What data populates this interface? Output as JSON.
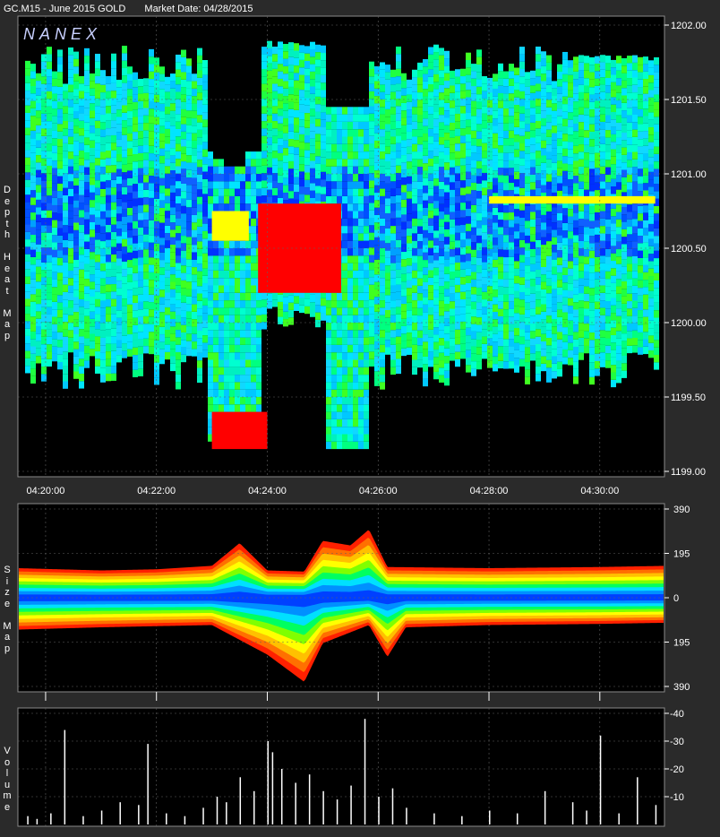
{
  "header": {
    "symbol": "GC.M15 - June 2015 GOLD",
    "market_date": "Market Date: 04/28/2015"
  },
  "brand": {
    "name": "NANEX"
  },
  "colors": {
    "background": "#000000",
    "panel_border": "#8a8a8a",
    "grid": "#606060",
    "heat_low": "#00e5ff",
    "heat_mid": "#00ff60",
    "heat_high": "#ffff00",
    "heat_max": "#ff0000",
    "heat_deep": "#0030ff",
    "volume_bar": "#ffffff"
  },
  "chart_data": [
    {
      "type": "heatmap",
      "title": "Depth Heat Map",
      "ylabel": "Depth Heat Map",
      "ylim": [
        1199.0,
        1202.0
      ],
      "y_ticks": [
        "1202.00",
        "1201.50",
        "1201.00",
        "1200.50",
        "1200.00",
        "1199.50",
        "1199.00"
      ],
      "x_ticks": [
        "04:20:00",
        "04:22:00",
        "04:24:00",
        "04:26:00",
        "04:28:00",
        "04:30:00"
      ],
      "x_range": [
        "04:19:30",
        "04:31:10"
      ],
      "grid": true,
      "hot_zones": [
        {
          "time_from": "04:23:50",
          "time_to": "04:25:20",
          "price_from": 1200.2,
          "price_to": 1200.8,
          "level": "max"
        },
        {
          "time_from": "04:23:00",
          "time_to": "04:23:40",
          "price_from": 1200.55,
          "price_to": 1200.75,
          "level": "high"
        },
        {
          "time_from": "04:28:00",
          "time_to": "04:31:00",
          "price_from": 1200.8,
          "price_to": 1200.85,
          "level": "high"
        },
        {
          "time_from": "04:23:00",
          "time_to": "04:24:00",
          "price_from": 1199.15,
          "price_to": 1199.4,
          "level": "max"
        }
      ]
    },
    {
      "type": "area",
      "title": "Size Map",
      "ylabel": "Size Map",
      "ylim": [
        -390,
        390
      ],
      "y_ticks": [
        "390",
        "195",
        "0",
        "195",
        "390"
      ],
      "grid": true,
      "upper_envelope": [
        {
          "t": "04:19:30",
          "v": 130
        },
        {
          "t": "04:21:00",
          "v": 120
        },
        {
          "t": "04:22:00",
          "v": 125
        },
        {
          "t": "04:23:00",
          "v": 140
        },
        {
          "t": "04:23:30",
          "v": 240
        },
        {
          "t": "04:24:00",
          "v": 120
        },
        {
          "t": "04:24:40",
          "v": 115
        },
        {
          "t": "04:25:00",
          "v": 250
        },
        {
          "t": "04:25:30",
          "v": 230
        },
        {
          "t": "04:25:50",
          "v": 300
        },
        {
          "t": "04:26:10",
          "v": 135
        },
        {
          "t": "04:28:00",
          "v": 130
        },
        {
          "t": "04:30:00",
          "v": 135
        },
        {
          "t": "04:31:10",
          "v": 140
        }
      ],
      "lower_envelope": [
        {
          "t": "04:19:30",
          "v": -140
        },
        {
          "t": "04:21:00",
          "v": -130
        },
        {
          "t": "04:22:00",
          "v": -125
        },
        {
          "t": "04:23:00",
          "v": -120
        },
        {
          "t": "04:24:00",
          "v": -250
        },
        {
          "t": "04:24:40",
          "v": -370
        },
        {
          "t": "04:25:00",
          "v": -200
        },
        {
          "t": "04:25:50",
          "v": -120
        },
        {
          "t": "04:26:10",
          "v": -260
        },
        {
          "t": "04:26:30",
          "v": -130
        },
        {
          "t": "04:28:00",
          "v": -120
        },
        {
          "t": "04:30:00",
          "v": -115
        },
        {
          "t": "04:31:10",
          "v": -110
        }
      ]
    },
    {
      "type": "bar",
      "title": "Volume",
      "ylabel": "Volume",
      "ylim": [
        0,
        40
      ],
      "y_ticks": [
        "40",
        "30",
        "20",
        "10"
      ],
      "grid": true,
      "bars": [
        {
          "t": "04:19:40",
          "v": 3
        },
        {
          "t": "04:19:50",
          "v": 2
        },
        {
          "t": "04:20:05",
          "v": 4
        },
        {
          "t": "04:20:20",
          "v": 34
        },
        {
          "t": "04:20:40",
          "v": 3
        },
        {
          "t": "04:21:00",
          "v": 5
        },
        {
          "t": "04:21:20",
          "v": 8
        },
        {
          "t": "04:21:40",
          "v": 7
        },
        {
          "t": "04:21:50",
          "v": 29
        },
        {
          "t": "04:22:10",
          "v": 4
        },
        {
          "t": "04:22:30",
          "v": 3
        },
        {
          "t": "04:22:50",
          "v": 6
        },
        {
          "t": "04:23:05",
          "v": 10
        },
        {
          "t": "04:23:15",
          "v": 8
        },
        {
          "t": "04:23:30",
          "v": 17
        },
        {
          "t": "04:23:45",
          "v": 12
        },
        {
          "t": "04:24:00",
          "v": 30
        },
        {
          "t": "04:24:05",
          "v": 26
        },
        {
          "t": "04:24:15",
          "v": 20
        },
        {
          "t": "04:24:30",
          "v": 15
        },
        {
          "t": "04:24:45",
          "v": 18
        },
        {
          "t": "04:25:00",
          "v": 12
        },
        {
          "t": "04:25:15",
          "v": 9
        },
        {
          "t": "04:25:30",
          "v": 14
        },
        {
          "t": "04:25:45",
          "v": 38
        },
        {
          "t": "04:26:00",
          "v": 10
        },
        {
          "t": "04:26:15",
          "v": 13
        },
        {
          "t": "04:26:30",
          "v": 6
        },
        {
          "t": "04:27:00",
          "v": 4
        },
        {
          "t": "04:27:30",
          "v": 3
        },
        {
          "t": "04:28:00",
          "v": 5
        },
        {
          "t": "04:28:30",
          "v": 4
        },
        {
          "t": "04:29:00",
          "v": 12
        },
        {
          "t": "04:29:30",
          "v": 8
        },
        {
          "t": "04:29:45",
          "v": 5
        },
        {
          "t": "04:30:00",
          "v": 32
        },
        {
          "t": "04:30:20",
          "v": 4
        },
        {
          "t": "04:30:40",
          "v": 17
        },
        {
          "t": "04:31:00",
          "v": 7
        }
      ]
    }
  ]
}
